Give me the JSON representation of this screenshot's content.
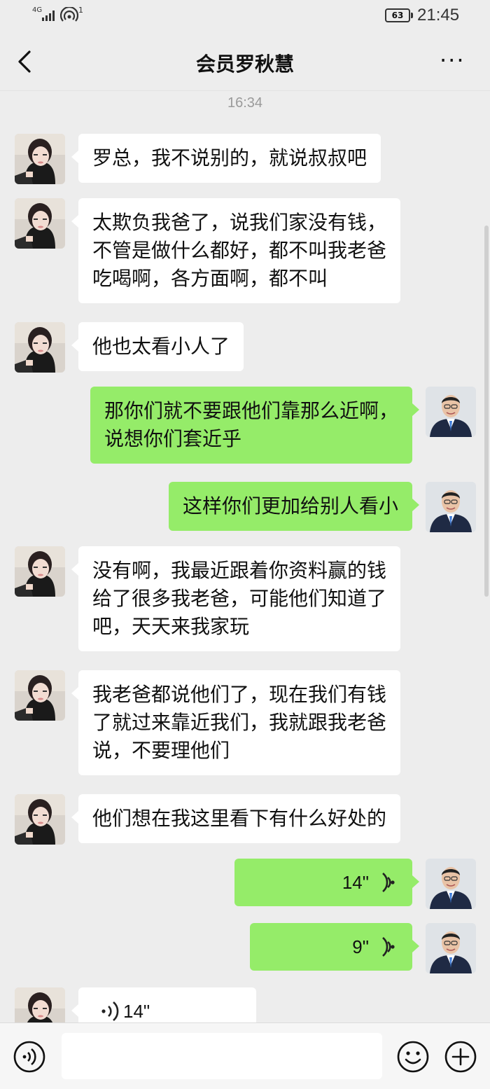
{
  "status_bar": {
    "network": "4G",
    "signal_sup": "1",
    "battery": "63",
    "time": "21:45"
  },
  "header": {
    "title": "会员罗秋慧",
    "more_label": "···"
  },
  "timestamp": "16:34",
  "messages": [
    {
      "side": "in",
      "text": "罗总，我不说别的，就说叔叔吧"
    },
    {
      "side": "in",
      "lines": [
        "太欺负我爸了，说我们家没有钱，",
        "不管是做什么都好，都不叫我老爸",
        "吃喝啊，各方面啊，都不叫"
      ]
    },
    {
      "side": "in",
      "text": "他也太看小人了"
    },
    {
      "side": "out",
      "lines": [
        "那你们就不要跟他们靠那么近啊，",
        "说想你们套近乎"
      ]
    },
    {
      "side": "out",
      "text": "这样你们更加给别人看小"
    },
    {
      "side": "in",
      "lines": [
        "没有啊，我最近跟着你资料赢的钱",
        "给了很多我老爸，可能他们知道了",
        "吧，天天来我家玩"
      ]
    },
    {
      "side": "in",
      "lines": [
        "我老爸都说他们了，现在我们有钱",
        "了就过来靠近我们，我就跟我老爸",
        "说，不要理他们"
      ]
    },
    {
      "side": "in",
      "text": "他们想在我这里看下有什么好处的"
    },
    {
      "side": "out",
      "type": "voice",
      "duration": "14\""
    },
    {
      "side": "out",
      "type": "voice",
      "duration": "9\""
    },
    {
      "side": "in",
      "type": "voice",
      "duration": "14\""
    }
  ],
  "input": {
    "placeholder": ""
  },
  "colors": {
    "background": "#ededed",
    "incoming_bubble": "#ffffff",
    "outgoing_bubble": "#95ec69"
  },
  "icons": {
    "back": "chevron-left-icon",
    "more": "more-dots-icon",
    "voice_toggle": "voice-icon",
    "emoji": "emoji-icon",
    "plus": "plus-icon"
  }
}
